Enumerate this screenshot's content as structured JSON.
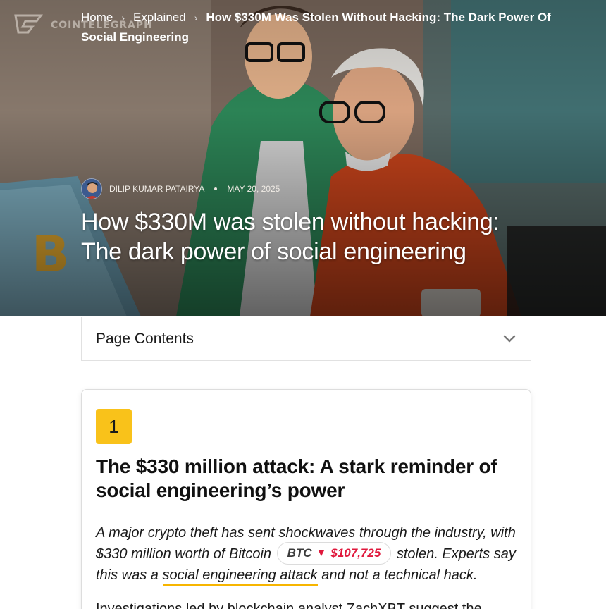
{
  "logo": {
    "text": "COINTELEGRAPH"
  },
  "breadcrumb": {
    "home": "Home",
    "section": "Explained",
    "current": "How $330M Was Stolen Without Hacking: The Dark Power Of Social Engineering"
  },
  "article": {
    "author": "DILIP KUMAR PATAIRYA",
    "date": "MAY 20, 2025",
    "title": "How $330M was stolen without hacking: The dark power of social engineering"
  },
  "toc": {
    "label": "Page Contents"
  },
  "section1": {
    "number": "1",
    "title": "The $330 million attack: A stark reminder of social engineering’s power",
    "intro_part1": "A major crypto theft has sent shockwaves through the industry, with $330 million worth of Bitcoin",
    "intro_part2": "stolen. Experts say this was a",
    "intro_link": "social engineering attack",
    "intro_part3": "and not a technical hack.",
    "next_para": "Investigations led by blockchain analyst ZachXBT suggest the"
  },
  "price_ticker": {
    "symbol": "BTC",
    "arrow": "▼",
    "price": "$107,725",
    "price_color": "#e0183c"
  },
  "colors": {
    "accent_yellow": "#f9c21a",
    "link_underline": "#f7b500"
  },
  "icons": [
    "cointelegraph-logo-icon",
    "breadcrumb-chevron-icon",
    "author-avatar",
    "chevron-down-icon",
    "price-down-arrow-icon"
  ]
}
